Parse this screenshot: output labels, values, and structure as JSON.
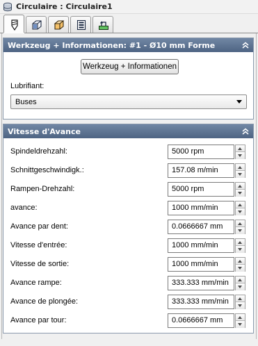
{
  "window": {
    "title": "Circulaire : Circulaire1"
  },
  "tabs": [
    {
      "name": "tool",
      "icon": "tool-bit-icon",
      "active": true
    },
    {
      "name": "geometry",
      "icon": "geometry-cube-icon",
      "active": false
    },
    {
      "name": "heights",
      "icon": "heights-box-icon",
      "active": false
    },
    {
      "name": "passes",
      "icon": "passes-icon",
      "active": false
    },
    {
      "name": "linking",
      "icon": "linking-icon",
      "active": false
    }
  ],
  "tool_panel": {
    "header": "Werkzeug + Informationen: #1 - Ø10 mm Forme",
    "button_label": "Werkzeug + Informationen",
    "lubricant_label": "Lubrifiant:",
    "lubricant_value": "Buses"
  },
  "feed_panel": {
    "header": "Vitesse d'Avance",
    "rows": [
      {
        "label": "Spindeldrehzahl:",
        "value": "5000 rpm"
      },
      {
        "label": "Schnittgeschwindigk.:",
        "value": "157.08 m/min"
      },
      {
        "label": "Rampen-Drehzahl:",
        "value": "5000 rpm"
      },
      {
        "label": "avance:",
        "value": "1000 mm/min"
      },
      {
        "label": "Avance par dent:",
        "value": "0.0666667 mm"
      },
      {
        "label": "Vitesse d'entrée:",
        "value": "1000 mm/min"
      },
      {
        "label": "Vitesse de sortie:",
        "value": "1000 mm/min"
      },
      {
        "label": "Avance rampe:",
        "value": "333.333 mm/min"
      },
      {
        "label": "Avance de plongée:",
        "value": "333.333 mm/min"
      },
      {
        "label": "Avance par tour:",
        "value": "0.0666667 mm"
      }
    ]
  },
  "colors": {
    "panel_header": "#5d7391",
    "panel_border": "#8b9aad",
    "background": "#f0f0f0"
  }
}
